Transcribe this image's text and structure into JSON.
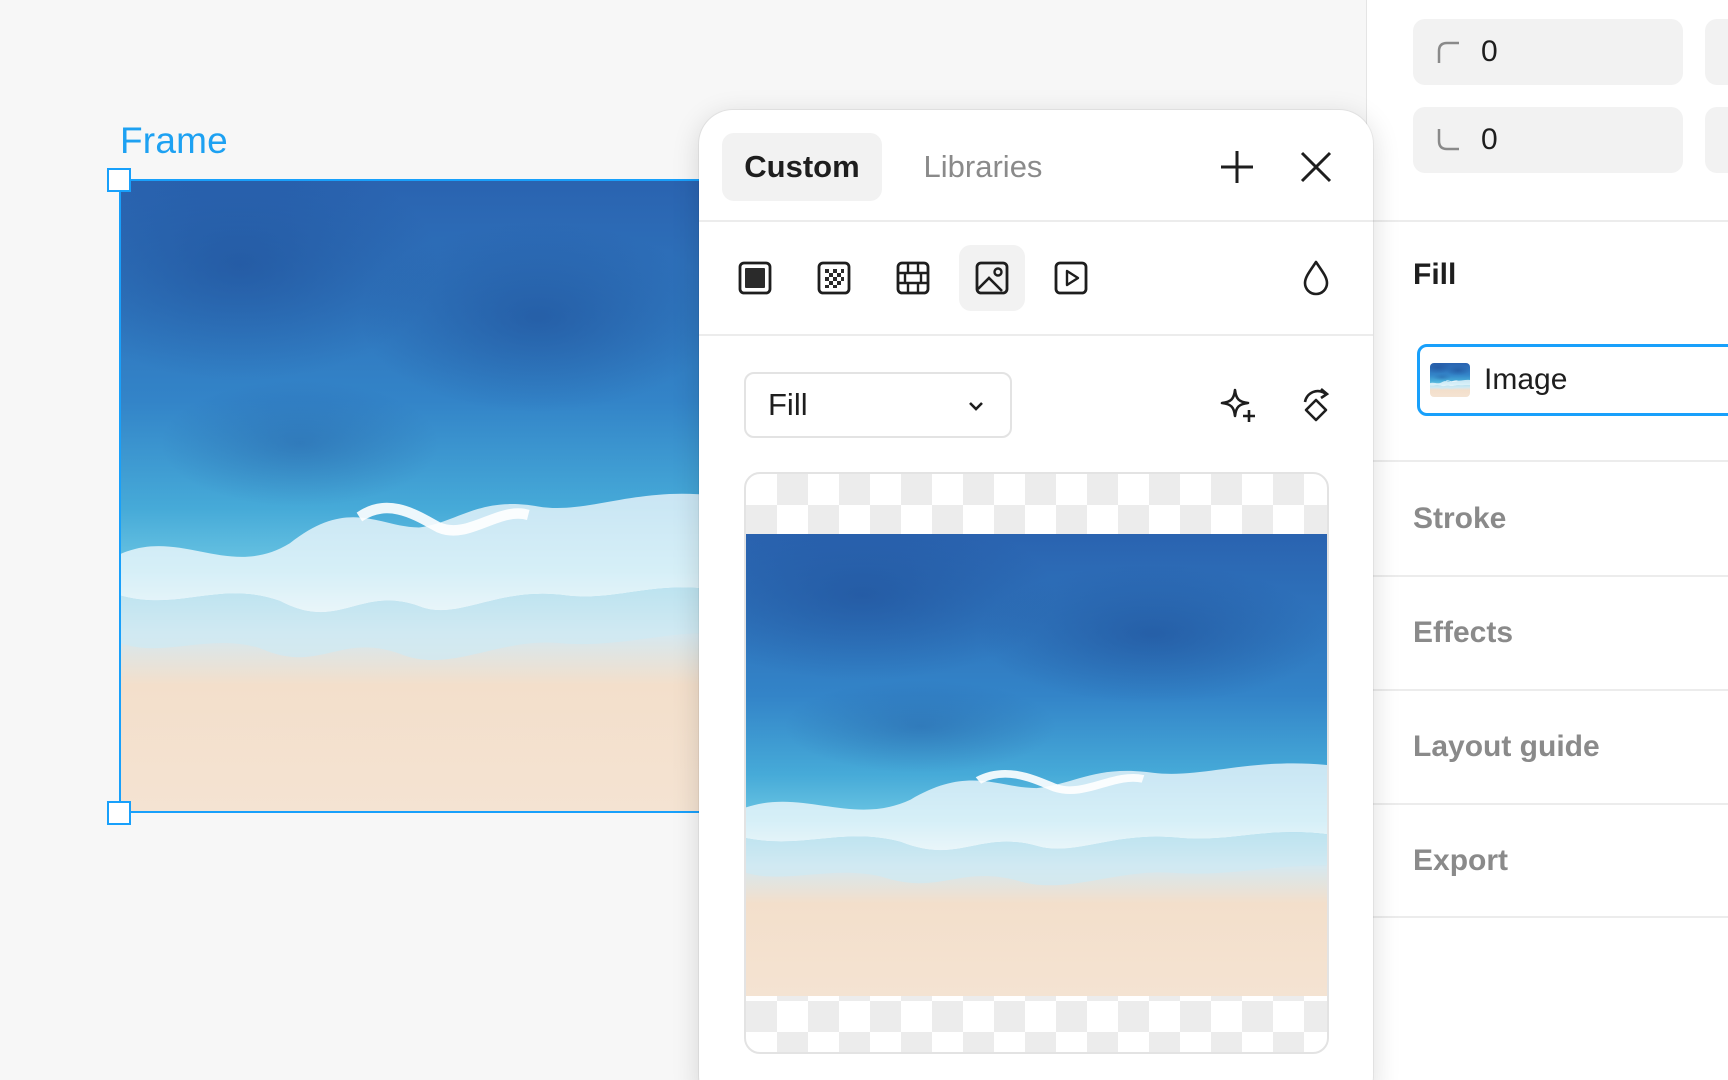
{
  "canvas": {
    "frame_label": "Frame"
  },
  "popup": {
    "tabs": {
      "custom": "Custom",
      "libraries": "Libraries"
    },
    "paint_types": [
      "solid",
      "gradient",
      "pattern",
      "image",
      "video"
    ],
    "selected_paint_type": "image",
    "image_mode": "Fill"
  },
  "properties": {
    "corner_radius": {
      "top_left": "0",
      "bottom_left": "0"
    },
    "fill": {
      "title": "Fill",
      "type_label": "Image"
    },
    "sections": {
      "stroke": "Stroke",
      "effects": "Effects",
      "layout_guide": "Layout guide",
      "export": "Export"
    }
  },
  "colors": {
    "selection": "#18a0fb",
    "deep_ocean": "#2f6fb8",
    "shallow_water": "#45a6d6",
    "sand": "#f2dcc4"
  },
  "icons": [
    "plus-icon",
    "close-icon",
    "solid-paint-icon",
    "gradient-paint-icon",
    "pattern-paint-icon",
    "image-paint-icon",
    "video-paint-icon",
    "drop-icon",
    "sparkle-icon",
    "rotate-icon",
    "chevron-down-icon",
    "corner-radius-icon"
  ]
}
